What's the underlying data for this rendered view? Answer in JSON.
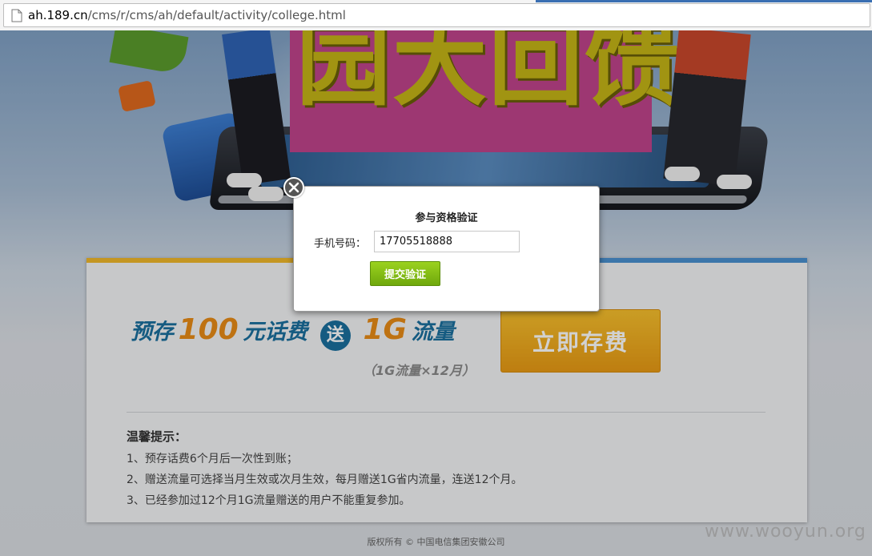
{
  "browser": {
    "url_host": "ah.189.cn",
    "url_path": "/cms/r/cms/ah/default/activity/college.html"
  },
  "banner": {
    "headline": "园大回馈"
  },
  "promo": {
    "part1": "预存",
    "amount": "100",
    "part2": "元话费",
    "badge": "送",
    "gift": "1G",
    "part3": "流量",
    "sub": "（1G流量×12月）",
    "cta_label": "立即存费"
  },
  "tips": {
    "title": "温馨提示：",
    "items": [
      "1、预存话费6个月后一次性到账；",
      "2、赠送流量可选择当月生效或次月生效，每月赠送1G省内流量，连送12个月。",
      "3、已经参加过12个月1G流量赠送的用户不能重复参加。"
    ]
  },
  "footer": {
    "copyright": "版权所有 © 中国电信集团安徽公司"
  },
  "watermark": "www.wooyun.org",
  "modal": {
    "title": "参与资格验证",
    "phone_label": "手机号码：",
    "phone_value": "17705518888",
    "submit_label": "提交验证"
  },
  "icons": {
    "close": "close-icon",
    "page": "page-icon"
  },
  "colors": {
    "submit_green": "#8cc417",
    "cta_orange": "#f0ad1f",
    "promo_blue": "#1a6f9e",
    "promo_orange": "#e88c16"
  }
}
